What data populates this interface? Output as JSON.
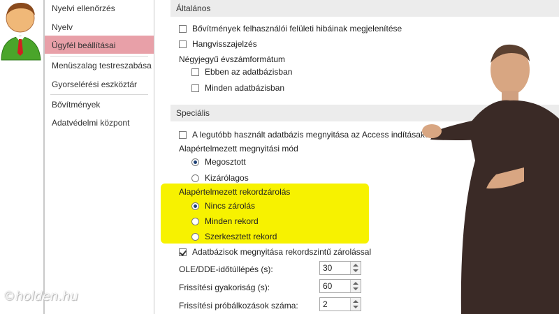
{
  "sidebar": {
    "items": [
      {
        "label": "Nyelvi ellenőrzés"
      },
      {
        "label": "Nyelv"
      },
      {
        "label": "Ügyfél beállításai"
      },
      {
        "label": "Menüszalag testreszabása"
      },
      {
        "label": "Gyorselérési eszköztár"
      },
      {
        "label": "Bővítmények"
      },
      {
        "label": "Adatvédelmi központ"
      }
    ]
  },
  "general": {
    "heading": "Általános",
    "show_addin_errors": "Bővítmények felhasználói felületi hibáinak megjelenítése",
    "sound_feedback": "Hangvisszajelzés",
    "four_digit_year": "Négyjegyű évszámformátum",
    "this_db": "Ebben az adatbázisban",
    "all_db": "Minden adatbázisban"
  },
  "special": {
    "heading": "Speciális",
    "open_last": "A legutóbb használt adatbázis megnyitása az Access indításakor",
    "default_open_mode": "Alapértelmezett megnyitási mód",
    "shared": "Megosztott",
    "exclusive": "Kizárólagos",
    "default_lock": "Alapértelmezett rekordzárolás",
    "no_locks": "Nincs zárolás",
    "all_records": "Minden rekord",
    "edited_record": "Szerkesztett rekord",
    "record_level_locking": "Adatbázisok megnyitása rekordszintű zárolással",
    "ole_timeout_label": "OLE/DDE-időtúllépés (s):",
    "ole_timeout_value": "30",
    "refresh_interval_label": "Frissítési gyakoriság (s):",
    "refresh_interval_value": "60",
    "update_retries_label": "Frissítési próbálkozások száma:",
    "update_retries_value": "2"
  },
  "watermark": "©holden.hu",
  "colors": {
    "selected_nav": "#e8a0a8",
    "highlight": "#f7f200"
  }
}
